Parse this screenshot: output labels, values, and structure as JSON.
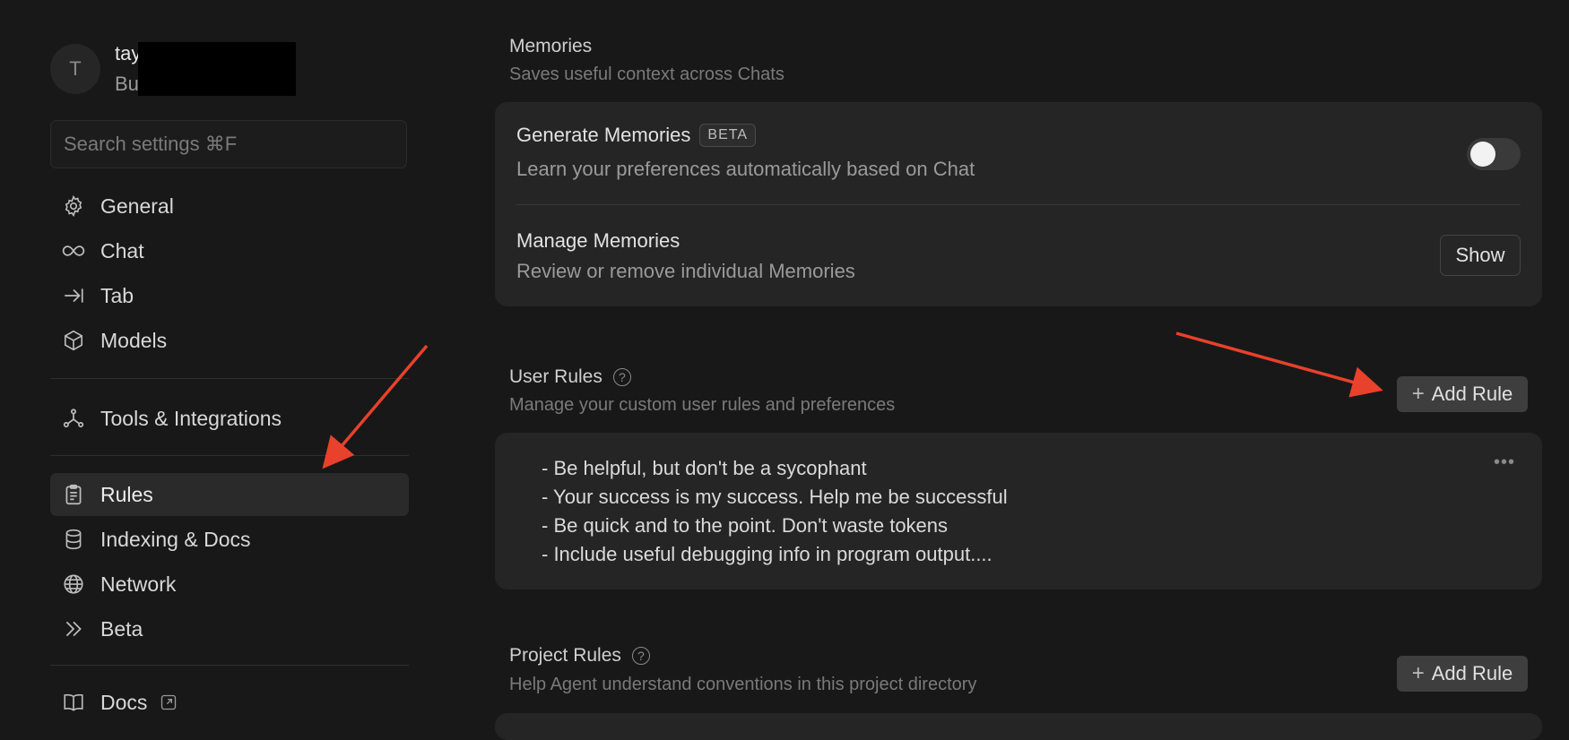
{
  "profile": {
    "avatar_letter": "T",
    "name_visible": "tay",
    "plan_visible": "Bu"
  },
  "search": {
    "placeholder": "Search settings ⌘F"
  },
  "sidebar": {
    "items": [
      {
        "label": "General",
        "icon": "gear-icon"
      },
      {
        "label": "Chat",
        "icon": "infinity-icon"
      },
      {
        "label": "Tab",
        "icon": "arrow-to-bar-icon"
      },
      {
        "label": "Models",
        "icon": "cube-icon"
      },
      {
        "label": "Tools & Integrations",
        "icon": "nodes-icon"
      },
      {
        "label": "Rules",
        "icon": "clipboard-icon",
        "active": true
      },
      {
        "label": "Indexing & Docs",
        "icon": "database-icon"
      },
      {
        "label": "Network",
        "icon": "globe-icon"
      },
      {
        "label": "Beta",
        "icon": "double-chevron-icon"
      },
      {
        "label": "Docs",
        "icon": "book-icon",
        "external_icon": "external-link-icon"
      }
    ]
  },
  "memories": {
    "title": "Memories",
    "subtitle": "Saves useful context across Chats",
    "generate": {
      "title": "Generate Memories",
      "badge": "BETA",
      "subtitle": "Learn your preferences automatically based on Chat",
      "enabled": false
    },
    "manage": {
      "title": "Manage Memories",
      "subtitle": "Review or remove individual Memories",
      "button": "Show"
    }
  },
  "user_rules": {
    "title": "User Rules",
    "subtitle": "Manage your custom user rules and preferences",
    "add_button": "Add Rule",
    "lines": [
      "- Be helpful, but don't be a sycophant",
      "- Your success is my success. Help me be successful",
      "- Be quick and to the point. Don't waste tokens",
      "- Include useful debugging info in program output...."
    ],
    "more_icon": "ellipsis-icon"
  },
  "project_rules": {
    "title": "Project Rules",
    "subtitle": "Help Agent understand conventions in this project directory",
    "add_button": "Add Rule"
  },
  "annotation_color": "#e8412c"
}
